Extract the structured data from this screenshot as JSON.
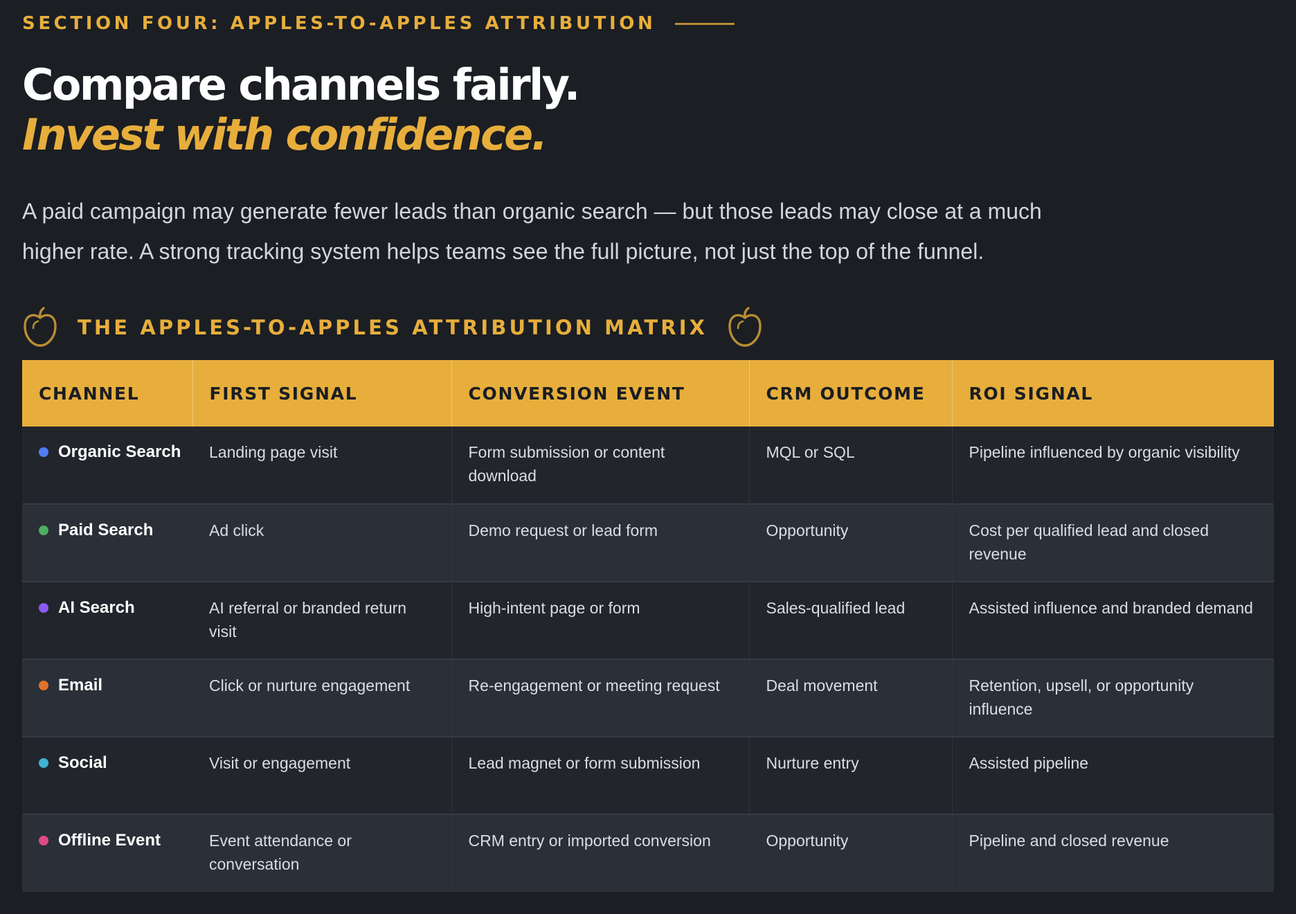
{
  "section": {
    "eyebrow": "SECTION FOUR: APPLES-TO-APPLES ATTRIBUTION",
    "headline_line1": "Compare channels fairly.",
    "headline_line2": "Invest with confidence.",
    "intro": "A paid campaign may generate fewer leads than organic search — but those leads may close at a much higher rate. A strong tracking system helps teams see the full picture, not just the top of the funnel."
  },
  "matrix": {
    "title": "THE APPLES-TO-APPLES ATTRIBUTION MATRIX",
    "icons": [
      "apple-icon",
      "apple-icon"
    ],
    "headers": [
      "CHANNEL",
      "FIRST SIGNAL",
      "CONVERSION EVENT",
      "CRM OUTCOME",
      "ROI SIGNAL"
    ],
    "rows": [
      {
        "channel": "Organic Search",
        "dot_color": "#4f7df3",
        "first_signal": "Landing page visit",
        "conversion_event": "Form submission or content download",
        "crm_outcome": "MQL or SQL",
        "roi_signal": "Pipeline influenced by organic visibility"
      },
      {
        "channel": "Paid Search",
        "dot_color": "#4caf62",
        "first_signal": "Ad click",
        "conversion_event": "Demo request or lead form",
        "crm_outcome": "Opportunity",
        "roi_signal": "Cost per qualified lead and closed revenue"
      },
      {
        "channel": "AI Search",
        "dot_color": "#8a5cf4",
        "first_signal": "AI referral or branded return visit",
        "conversion_event": "High-intent page or form",
        "crm_outcome": "Sales-qualified lead",
        "roi_signal": "Assisted influence and branded demand"
      },
      {
        "channel": "Email",
        "dot_color": "#e0732a",
        "first_signal": "Click or nurture engagement",
        "conversion_event": "Re-engagement or meeting request",
        "crm_outcome": "Deal movement",
        "roi_signal": "Retention, upsell, or opportunity influence"
      },
      {
        "channel": "Social",
        "dot_color": "#3fb3d6",
        "first_signal": "Visit or engagement",
        "conversion_event": "Lead magnet or form submission",
        "crm_outcome": "Nurture entry",
        "roi_signal": "Assisted pipeline"
      },
      {
        "channel": "Offline Event",
        "dot_color": "#e0498b",
        "first_signal": "Event attendance or conversation",
        "conversion_event": "CRM entry or imported conversion",
        "crm_outcome": "Opportunity",
        "roi_signal": "Pipeline and closed revenue"
      }
    ]
  },
  "colors": {
    "background": "#1b1e23",
    "accent": "#e7ae3c",
    "row_dark": "#22252c",
    "row_light": "#2b2f37"
  }
}
